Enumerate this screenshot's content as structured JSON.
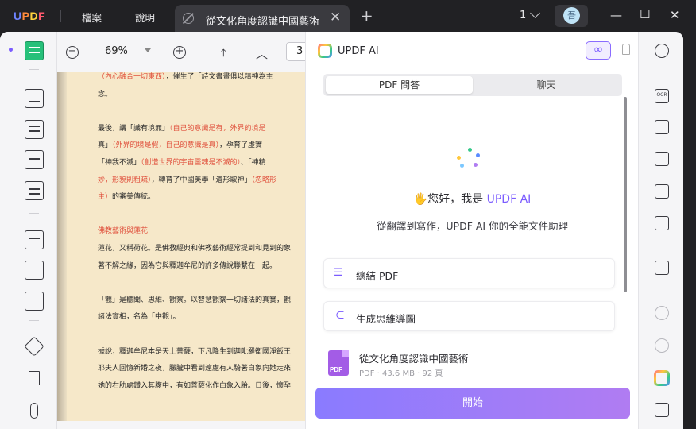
{
  "app": {
    "logo": "UPDF"
  },
  "menu": [
    "檔案",
    "說明"
  ],
  "tab": {
    "title": "從文化角度認識中國藝術",
    "close": "✕"
  },
  "new_tab": "+",
  "page_count": "1",
  "avatar": {
    "initial": "吾"
  },
  "window_controls": {
    "minimize": "—",
    "maximize": "☐",
    "close": "✕"
  },
  "toolbar": {
    "zoom": "69%",
    "page": "3",
    "zoom_out": "−",
    "zoom_in": "+",
    "first_page": "⤒",
    "prev_page": "︿"
  },
  "document": {
    "lines": [
      {
        "parts": [
          {
            "t": "（內心融合一切東西）",
            "c": "r"
          },
          {
            "t": "，催生了「詩文書畫俱以精神為主"
          }
        ]
      },
      {
        "parts": [
          {
            "t": "念。"
          }
        ]
      },
      {
        "gap": true
      },
      {
        "parts": [
          {
            "t": "最後，講「識有境無」"
          },
          {
            "t": "（自己的意識是有，外界的境是",
            "c": "r"
          }
        ]
      },
      {
        "parts": [
          {
            "t": "真」"
          },
          {
            "t": "（外界的境是假，自己的意識是真）",
            "c": "r"
          },
          {
            "t": "，孕育了虛實"
          }
        ]
      },
      {
        "parts": [
          {
            "t": "「神我不滅」"
          },
          {
            "t": "（創造世界的宇宙靈魂是不滅的）",
            "c": "r"
          },
          {
            "t": "、「神精"
          }
        ]
      },
      {
        "parts": [
          {
            "t": "妙，形貌則粗疏）",
            "c": "r"
          },
          {
            "t": "，轉育了中國美學「遺形取神」"
          },
          {
            "t": "（忽略形",
            "c": "r"
          }
        ]
      },
      {
        "parts": [
          {
            "t": "主）",
            "c": "r"
          },
          {
            "t": "的審美傳統。"
          }
        ]
      },
      {
        "gap": true
      },
      {
        "parts": [
          {
            "t": "佛教藝術與蓮花",
            "c": "r"
          }
        ]
      },
      {
        "parts": [
          {
            "t": "蓮花，又稱荷花。是佛教經典和佛教藝術經常提到和見到的象"
          }
        ]
      },
      {
        "parts": [
          {
            "t": "著不解之緣，因為它與釋迦牟尼的許多傳說聯繫在一起。"
          }
        ]
      },
      {
        "gap": true
      },
      {
        "parts": [
          {
            "t": "「觀」是聽聞、思維、觀察。以智慧觀察一切諸法的真實，觀"
          }
        ]
      },
      {
        "parts": [
          {
            "t": "諸法實相，名為「中觀」。"
          }
        ]
      },
      {
        "gap": true
      },
      {
        "parts": [
          {
            "t": "據說，釋迦牟尼本是天上菩薩，下凡降生到迦毗羅衛國淨飯王"
          }
        ]
      },
      {
        "parts": [
          {
            "t": "耶夫人回憶新婚之夜，朦朧中看到遠處有人騎著白象向她走來"
          }
        ]
      },
      {
        "parts": [
          {
            "t": "她的右肋處鑽入其腹中，有如菩薩化作白象入胎。日後，懷孕"
          }
        ]
      }
    ]
  },
  "ai": {
    "title": "UPDF AI",
    "infinity": "∞",
    "tabs": [
      "PDF 問答",
      "聊天"
    ],
    "greeting_prefix": "🖐您好，我是 ",
    "greeting_highlight": "UPDF AI",
    "subtitle": "從翻譯到寫作，UPDF AI 你的全能文件助理",
    "actions": [
      {
        "icon": "☰",
        "label": "總結 PDF"
      },
      {
        "icon": "⋲",
        "label": "生成思維導圖"
      }
    ],
    "file": {
      "name": "從文化角度認識中國藝術",
      "meta": "PDF · 43.6 MB · 92 頁",
      "badge": "PDF"
    },
    "start_label": "開始"
  },
  "right_tools": {
    "ocr": "OCR"
  },
  "colors": {
    "accent": "#7b5cff",
    "active_tool": "#27c07a",
    "doc_bg": "#f6e8c9",
    "red_text": "#e0503c"
  }
}
